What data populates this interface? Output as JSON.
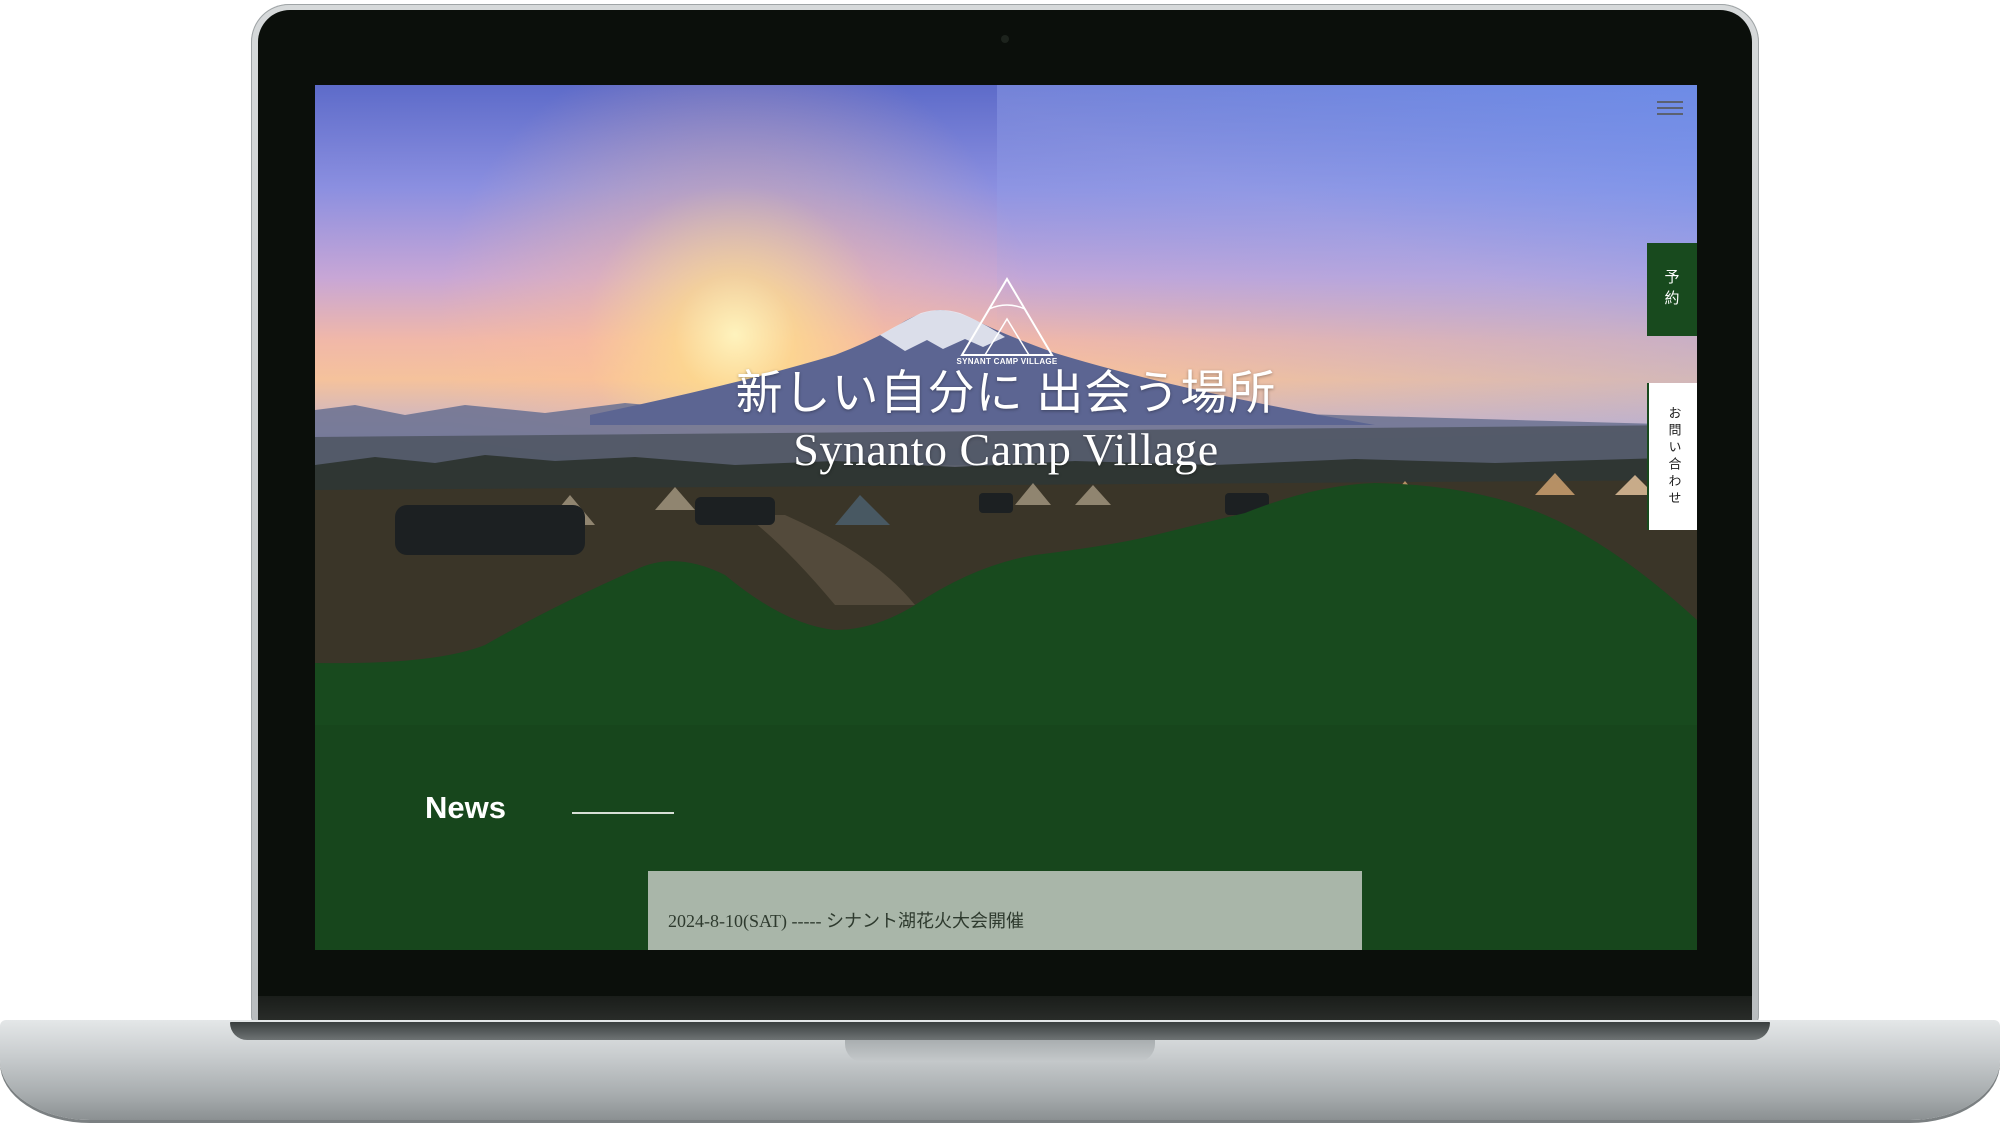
{
  "header": {
    "menu_icon": "hamburger-menu-icon"
  },
  "logo": {
    "text": "SYNANT CAMP VILLAGE"
  },
  "hero": {
    "title_jp": "新しい自分に 出会う場所",
    "title_en": "Synanto Camp Village"
  },
  "side_tabs": {
    "reserve_label": "予約",
    "contact_label": "お問い合わせ"
  },
  "news": {
    "heading": "News",
    "items": [
      {
        "text": "2024-8-10(SAT) ----- シナント湖花火大会開催"
      }
    ]
  },
  "colors": {
    "primary_green": "#184a1e",
    "news_card_bg": "#a9b6a9",
    "laptop_bezel": "#0b0f0b"
  }
}
